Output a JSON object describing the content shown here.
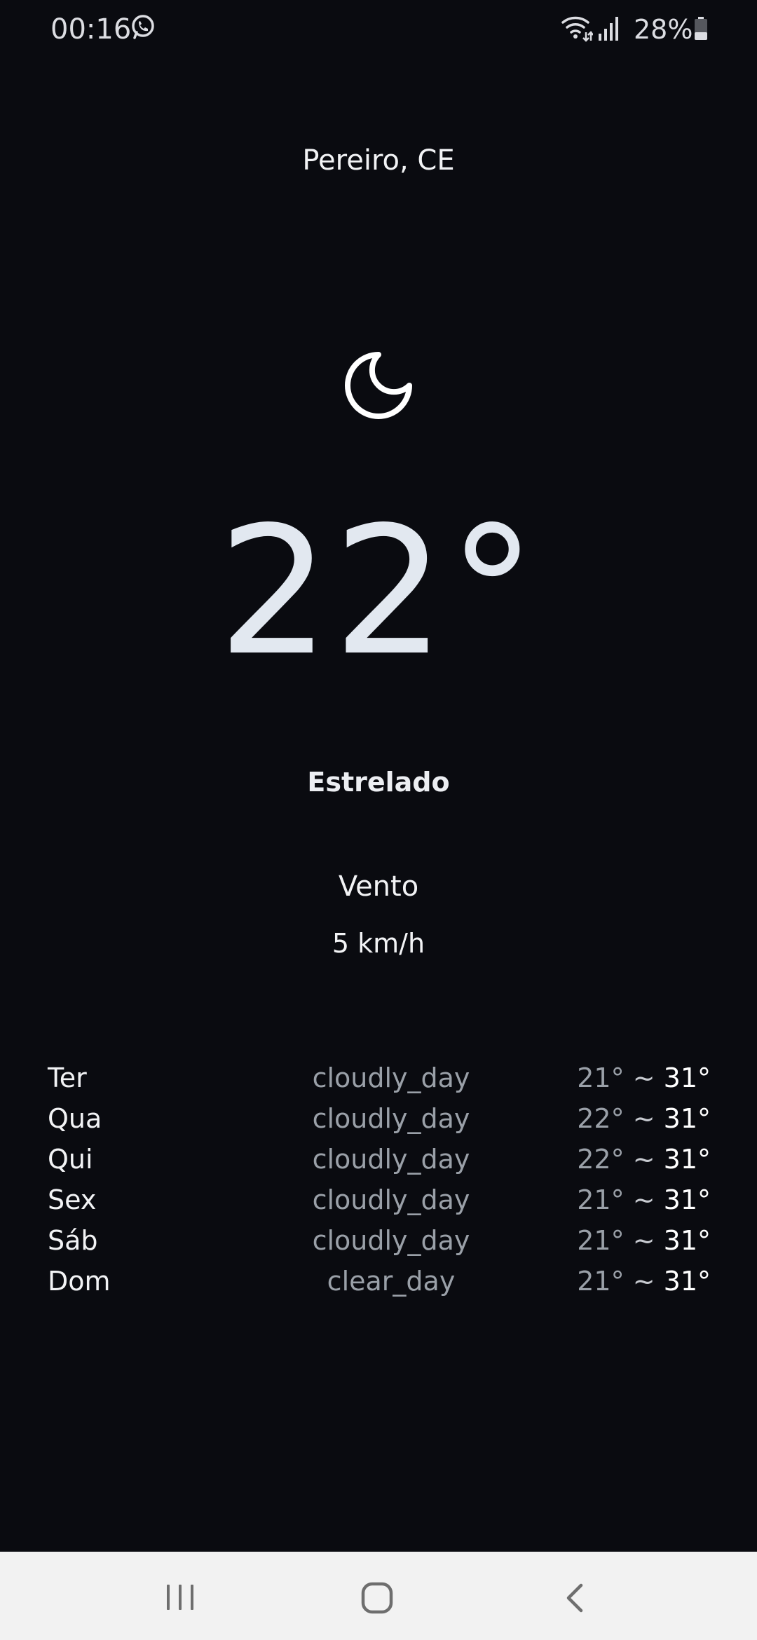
{
  "status_bar": {
    "time": "00:16",
    "battery": "28%",
    "icons": [
      "whatsapp-icon",
      "wifi-icon",
      "signal-icon",
      "battery-icon"
    ]
  },
  "weather": {
    "location": "Pereiro, CE",
    "icon": "moon-icon",
    "temperature": "22°",
    "condition": "Estrelado",
    "wind_label": "Vento",
    "wind_value": "5 km/h"
  },
  "forecast": [
    {
      "day": "Ter",
      "condition": "cloudly_day",
      "min": "21°",
      "sep": "~",
      "max": "31°"
    },
    {
      "day": "Qua",
      "condition": "cloudly_day",
      "min": "22°",
      "sep": "~",
      "max": "31°"
    },
    {
      "day": "Qui",
      "condition": "cloudly_day",
      "min": "22°",
      "sep": "~",
      "max": "31°"
    },
    {
      "day": "Sex",
      "condition": "cloudly_day",
      "min": "21°",
      "sep": "~",
      "max": "31°"
    },
    {
      "day": "Sáb",
      "condition": "cloudly_day",
      "min": "21°",
      "sep": "~",
      "max": "31°"
    },
    {
      "day": "Dom",
      "condition": "clear_day",
      "min": "21°",
      "sep": "~",
      "max": "31°"
    }
  ],
  "nav_bar": {
    "icons": [
      "recents-icon",
      "home-icon",
      "back-icon"
    ]
  },
  "colors": {
    "background": "#0a0b10",
    "muted_text": "#9aa0a8",
    "temperature": "#e2e8f0",
    "nav_background": "#f2f2f2"
  }
}
